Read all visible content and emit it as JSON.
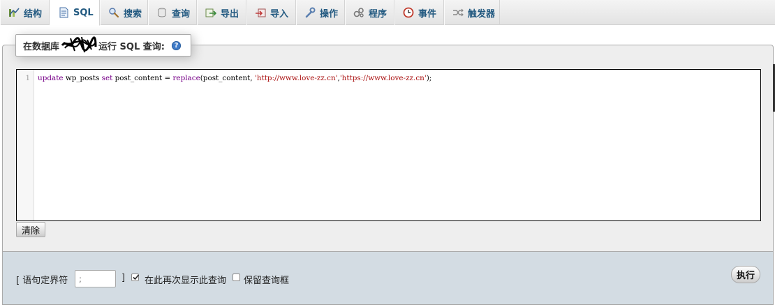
{
  "tabs": [
    {
      "label": "结构",
      "icon": "structure-icon",
      "active": false
    },
    {
      "label": "SQL",
      "icon": "sql-page-icon",
      "active": true
    },
    {
      "label": "搜索",
      "icon": "search-icon",
      "active": false
    },
    {
      "label": "查询",
      "icon": "query-icon",
      "active": false
    },
    {
      "label": "导出",
      "icon": "export-icon",
      "active": false
    },
    {
      "label": "导入",
      "icon": "import-icon",
      "active": false
    },
    {
      "label": "操作",
      "icon": "wrench-icon",
      "active": false
    },
    {
      "label": "程序",
      "icon": "routines-icon",
      "active": false
    },
    {
      "label": "事件",
      "icon": "clock-icon",
      "active": false
    },
    {
      "label": "触发器",
      "icon": "triggers-icon",
      "active": false
    }
  ],
  "query_box": {
    "legend_prefix": "在数据库",
    "legend_suffix": "运行 SQL 查询:",
    "help_icon": "help-icon",
    "line_number": "1",
    "sql": {
      "kw_update": "update",
      "t1": " wp_posts ",
      "kw_set": "set",
      "t2": " post_content = ",
      "fn_replace": "replace",
      "t3": "(post_content, ",
      "str1": "'http://www.love-zz.cn'",
      "t4": ",",
      "str2": "'https://www.love-zz.cn'",
      "t5": ");"
    },
    "clear_label": "清除"
  },
  "footer": {
    "delimiter_label": "[ 语句定界符",
    "delimiter_value": ";",
    "delimiter_close": "]",
    "show_again_label": "在此再次显示此查询",
    "show_again_checked": true,
    "retain_box_label": "保留查询框",
    "retain_box_checked": false,
    "execute_label": "执行"
  },
  "colors": {
    "tab_text": "#235a81",
    "keyword": "#770088",
    "string": "#aa1111",
    "footer_bg": "#d3dce3",
    "fieldset_bg": "#eeeeee"
  }
}
